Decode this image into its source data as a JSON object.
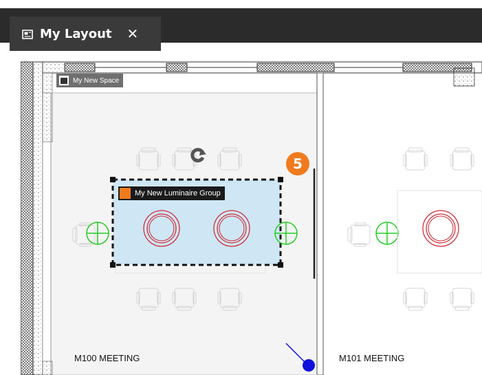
{
  "tab": {
    "title": "My Layout",
    "close_glyph": "✕",
    "icon": "layout-icon"
  },
  "canvas": {
    "space_tag": "My New Space",
    "group_tag": "My New Luminaire Group",
    "badge": "5",
    "rotate_icon": "rotate-icon",
    "rooms": [
      {
        "label": "M100 MEETING"
      },
      {
        "label": "M101 MEETING"
      }
    ]
  },
  "colors": {
    "tab_bg": "#3a3a3a",
    "tabstrip_bg": "#2b2b2b",
    "selection_fill": "#cfe6f5",
    "luminaire": "#d0303a",
    "pivot": "#22cc22",
    "accent": "#f07a1e",
    "handle": "#1010dd"
  }
}
